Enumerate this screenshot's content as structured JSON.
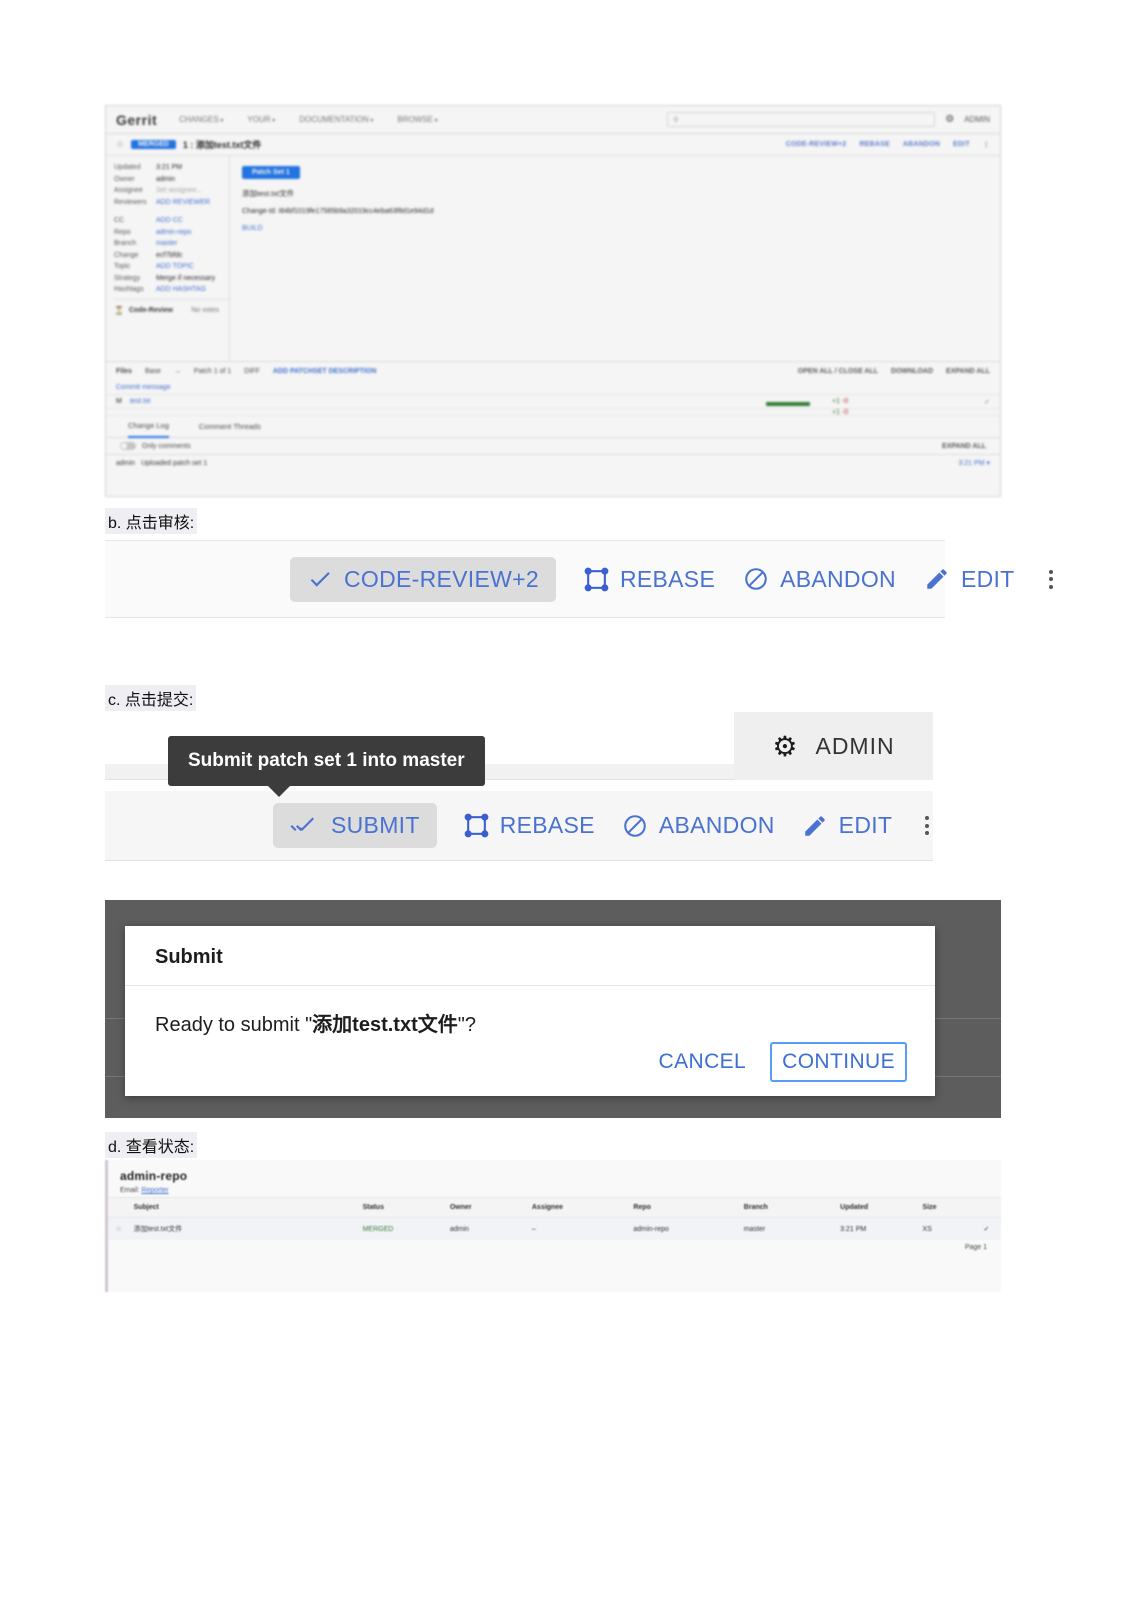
{
  "gerrit_change_page": {
    "logo": "Gerrit",
    "nav": [
      "CHANGES",
      "YOUR",
      "DOCUMENTATION",
      "BROWSE"
    ],
    "search_placeholder": "",
    "search_icon": "search-icon",
    "gear_icon": "gear-icon",
    "account_label": "ADMIN",
    "star_icon": "star-icon",
    "status_badge": "MERGED",
    "change_title": "1 : 添加test.txt文件",
    "actions": [
      "CODE-REVIEW+2",
      "REBASE",
      "ABANDON",
      "EDIT"
    ],
    "metadata": [
      {
        "key": "Updated",
        "value": "3:21 PM",
        "kind": "plain"
      },
      {
        "key": "Owner",
        "value": "admin",
        "kind": "plain"
      },
      {
        "key": "Assignee",
        "value": "Set assignee...",
        "kind": "muted"
      },
      {
        "key": "Reviewers",
        "value": "ADD REVIEWER",
        "kind": "link"
      },
      {
        "key": "CC",
        "value": "ADD CC",
        "kind": "link"
      },
      {
        "key": "Repo",
        "value": "admin-repo",
        "kind": "link"
      },
      {
        "key": "Branch",
        "value": "master",
        "kind": "link"
      },
      {
        "key": "Change",
        "value": "ecf7bfdc",
        "kind": "plain"
      },
      {
        "key": "Topic",
        "value": "ADD TOPIC",
        "kind": "link"
      },
      {
        "key": "Strategy",
        "value": "Merge if necessary",
        "kind": "plain"
      },
      {
        "key": "Hashtags",
        "value": "ADD HASHTAG",
        "kind": "link"
      }
    ],
    "code_review_label": "Code-Review",
    "code_review_value": "No votes",
    "patch_set_badge": "Patch Set 1",
    "commit_message": "添加test.txt文件",
    "change_id_line": "Change-Id: I84bf1019fe17585b9a32019cc4eba63f8d1e94d1d",
    "message_link": "BUILD",
    "files_label": "Files",
    "files_base": "Base",
    "files_patch": "Patch 1 of 1",
    "files_diff": "DIFF",
    "files_add_desc": "ADD PATCHSET DESCRIPTION",
    "files_right": [
      "OPEN ALL / CLOSE ALL",
      "DOWNLOAD",
      "EXPAND ALL"
    ],
    "commit_message_row": "Commit message",
    "file_status": "M",
    "file_name": "test.txt",
    "file_added": "+1",
    "file_removed": "-0",
    "tabs": [
      "Change Log",
      "Comment Threads"
    ],
    "only_comments_label": "Only comments",
    "expand_all_label": "EXPAND ALL",
    "log_author": "admin",
    "log_text": "Uploaded patch set 1",
    "log_time": "3:21 PM"
  },
  "section_b": {
    "caption": "b. 点击审核:",
    "buttons": [
      {
        "label": "CODE-REVIEW+2",
        "icon": "check-icon",
        "highlighted": true
      },
      {
        "label": "REBASE",
        "icon": "rebase-icon",
        "highlighted": false
      },
      {
        "label": "ABANDON",
        "icon": "block-icon",
        "highlighted": false
      },
      {
        "label": "EDIT",
        "icon": "pencil-icon",
        "highlighted": false
      }
    ],
    "overflow_icon": "kebab-menu-icon"
  },
  "section_c": {
    "caption": "c. 点击提交:",
    "tooltip": "Submit patch set 1 into master",
    "gear_icon": "gear-icon",
    "account_label": "ADMIN",
    "buttons": [
      {
        "label": "SUBMIT",
        "icon": "double-check-icon",
        "highlighted": true
      },
      {
        "label": "REBASE",
        "icon": "rebase-icon",
        "highlighted": false
      },
      {
        "label": "ABANDON",
        "icon": "block-icon",
        "highlighted": false
      },
      {
        "label": "EDIT",
        "icon": "pencil-icon",
        "highlighted": false
      }
    ],
    "overflow_icon": "kebab-menu-icon"
  },
  "submit_dialog": {
    "title": "Submit",
    "message_prefix": "Ready to submit \"",
    "message_change": "添加test.txt文件",
    "message_suffix": "\"?",
    "cancel_label": "CANCEL",
    "continue_label": "CONTINUE"
  },
  "section_d": {
    "caption": "d. 查看状态:",
    "repo_title": "admin-repo",
    "sub_label": "Email:",
    "sub_link": "Reporter",
    "columns": [
      "",
      "Subject",
      "Status",
      "Owner",
      "Assignee",
      "Repo",
      "Branch",
      "Updated",
      "Size",
      ""
    ],
    "rows": [
      {
        "star_icon": "star-outline-icon",
        "subject": "添加test.txt文件",
        "status": "MERGED",
        "owner": "admin",
        "assignee": "–",
        "repo": "admin-repo",
        "branch": "master",
        "updated": "3:21 PM",
        "size": "XS",
        "check_icon": "check-icon"
      }
    ],
    "footer": "Page 1"
  },
  "colors": {
    "accent_blue": "#3b6fd4",
    "merged_green": "#2e7d32",
    "chip_grey": "#dcdcdc",
    "tooltip_bg": "#3c3c3c",
    "dialog_backdrop": "#5d5d5d"
  }
}
